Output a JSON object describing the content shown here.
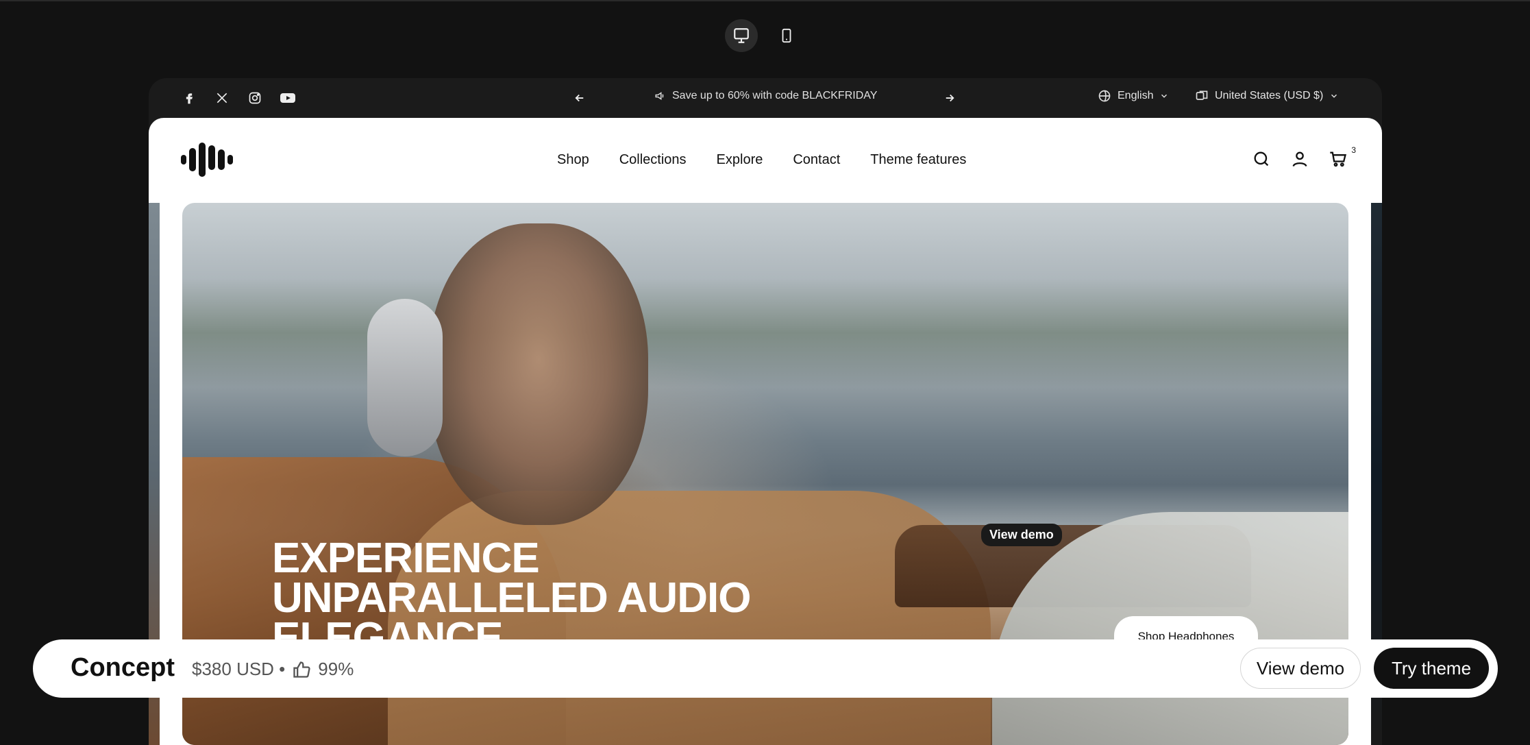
{
  "announcement": {
    "promo_text": "Save up to 60% with code BLACKFRIDAY",
    "language": "English",
    "country": "United States (USD $)"
  },
  "social": [
    "facebook-icon",
    "x-icon",
    "instagram-icon",
    "youtube-icon"
  ],
  "nav": {
    "items": [
      "Shop",
      "Collections",
      "Explore",
      "Contact",
      "Theme features"
    ]
  },
  "header": {
    "cart_count": "3"
  },
  "hero": {
    "title_lines": [
      "EXPERIENCE",
      "UNPARALLELED AUDIO",
      "ELEGANCE"
    ],
    "view_demo_label": "View demo",
    "shop_button_label": "Shop Headphones"
  },
  "bottom_bar": {
    "theme_name": "Concept",
    "price": "$380 USD •",
    "rating": "99%",
    "view_demo_label": "View demo",
    "try_theme_label": "Try theme"
  },
  "colors": {
    "background": "#121212",
    "accent_dark": "#111111",
    "announcement_bg": "#1b1b1b"
  }
}
